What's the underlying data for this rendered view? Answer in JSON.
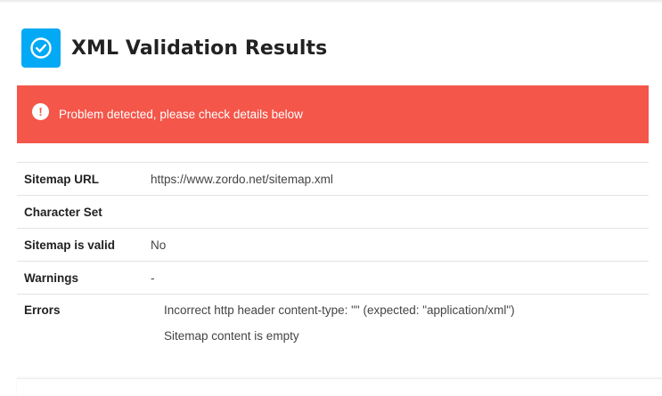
{
  "header": {
    "title": "XML Validation Results",
    "icon": "check-circle-icon",
    "icon_color": "#03a9f4"
  },
  "alert": {
    "message": "Problem detected, please check details below",
    "icon": "exclamation-icon",
    "background": "#f4564a"
  },
  "results": {
    "sitemap_url": {
      "label": "Sitemap URL",
      "value": "https://www.zordo.net/sitemap.xml"
    },
    "character_set": {
      "label": "Character Set",
      "value": ""
    },
    "sitemap_valid": {
      "label": "Sitemap is valid",
      "value": "No"
    },
    "warnings": {
      "label": "Warnings",
      "value": "-"
    },
    "errors": {
      "label": "Errors",
      "items": [
        "Incorrect http header content-type: \"\" (expected: \"application/xml\")",
        "Sitemap content is empty"
      ]
    }
  }
}
